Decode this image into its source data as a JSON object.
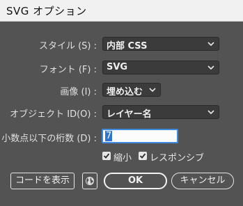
{
  "window": {
    "title": "SVG オプション"
  },
  "form": {
    "style": {
      "label": "スタイル (S) :",
      "value": "内部 CSS"
    },
    "font": {
      "label": "フォント (F) :",
      "value": "SVG"
    },
    "image": {
      "label": "画像 (I) :",
      "value": "埋め込む"
    },
    "object_id": {
      "label": "オブジェクト ID(O) :",
      "value": "レイヤー名"
    },
    "decimal_places": {
      "label": "小数点以下の桁数 (D) :",
      "value": "7"
    }
  },
  "options": {
    "minify": {
      "label": "縮小",
      "checked": true
    },
    "responsive": {
      "label": "レスポンシブ",
      "checked": true
    }
  },
  "buttons": {
    "show_code": "コードを表示",
    "ok": "OK",
    "cancel": "キャンセル"
  },
  "icons": {
    "dropdown": "chevron-down-icon",
    "checkbox": "checkmark-icon",
    "globe": "globe-icon"
  },
  "colors": {
    "dialog_bg": "#535353",
    "titlebar_bg": "#f1f1f1",
    "focus_border": "#3d8be0"
  }
}
